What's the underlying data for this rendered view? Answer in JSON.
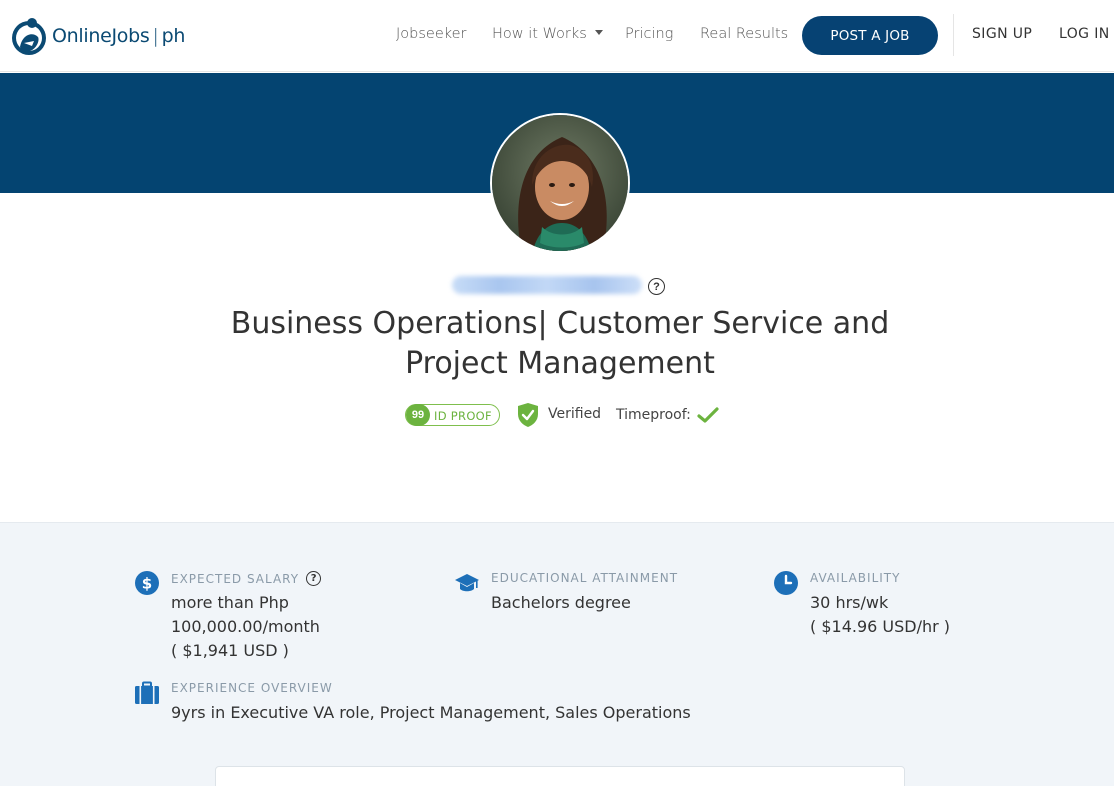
{
  "nav": {
    "logo_name": "OnlineJobs",
    "logo_suffix": "ph",
    "links": [
      "Jobseeker",
      "How it Works",
      "Pricing",
      "Real Results"
    ],
    "post_job": "POST A JOB",
    "sign_up": "SIGN UP",
    "log_in": "LOG IN"
  },
  "profile": {
    "headline_line1": "Business Operations| Customer Service and",
    "headline_line2": "Project Management",
    "id_proof_score": "99",
    "id_proof_label": "ID PROOF",
    "verified_label": "Verified",
    "timeproof_label": "Timeproof:",
    "help_glyph": "?"
  },
  "details": {
    "salary": {
      "label": "EXPECTED SALARY",
      "lines": [
        "more than Php",
        "100,000.00/month",
        "( $1,941 USD )"
      ]
    },
    "education": {
      "label": "EDUCATIONAL ATTAINMENT",
      "lines": [
        "Bachelors degree"
      ]
    },
    "availability": {
      "label": "AVAILABILITY",
      "lines": [
        "30 hrs/wk",
        "( $14.96 USD/hr )"
      ]
    },
    "experience": {
      "label": "EXPERIENCE OVERVIEW",
      "lines": [
        "9yrs in Executive VA role, Project Management, Sales Operations"
      ]
    }
  },
  "colors": {
    "brand": "#044471",
    "accent_green": "#6cb33f",
    "icon_blue": "#1d6fb8"
  }
}
